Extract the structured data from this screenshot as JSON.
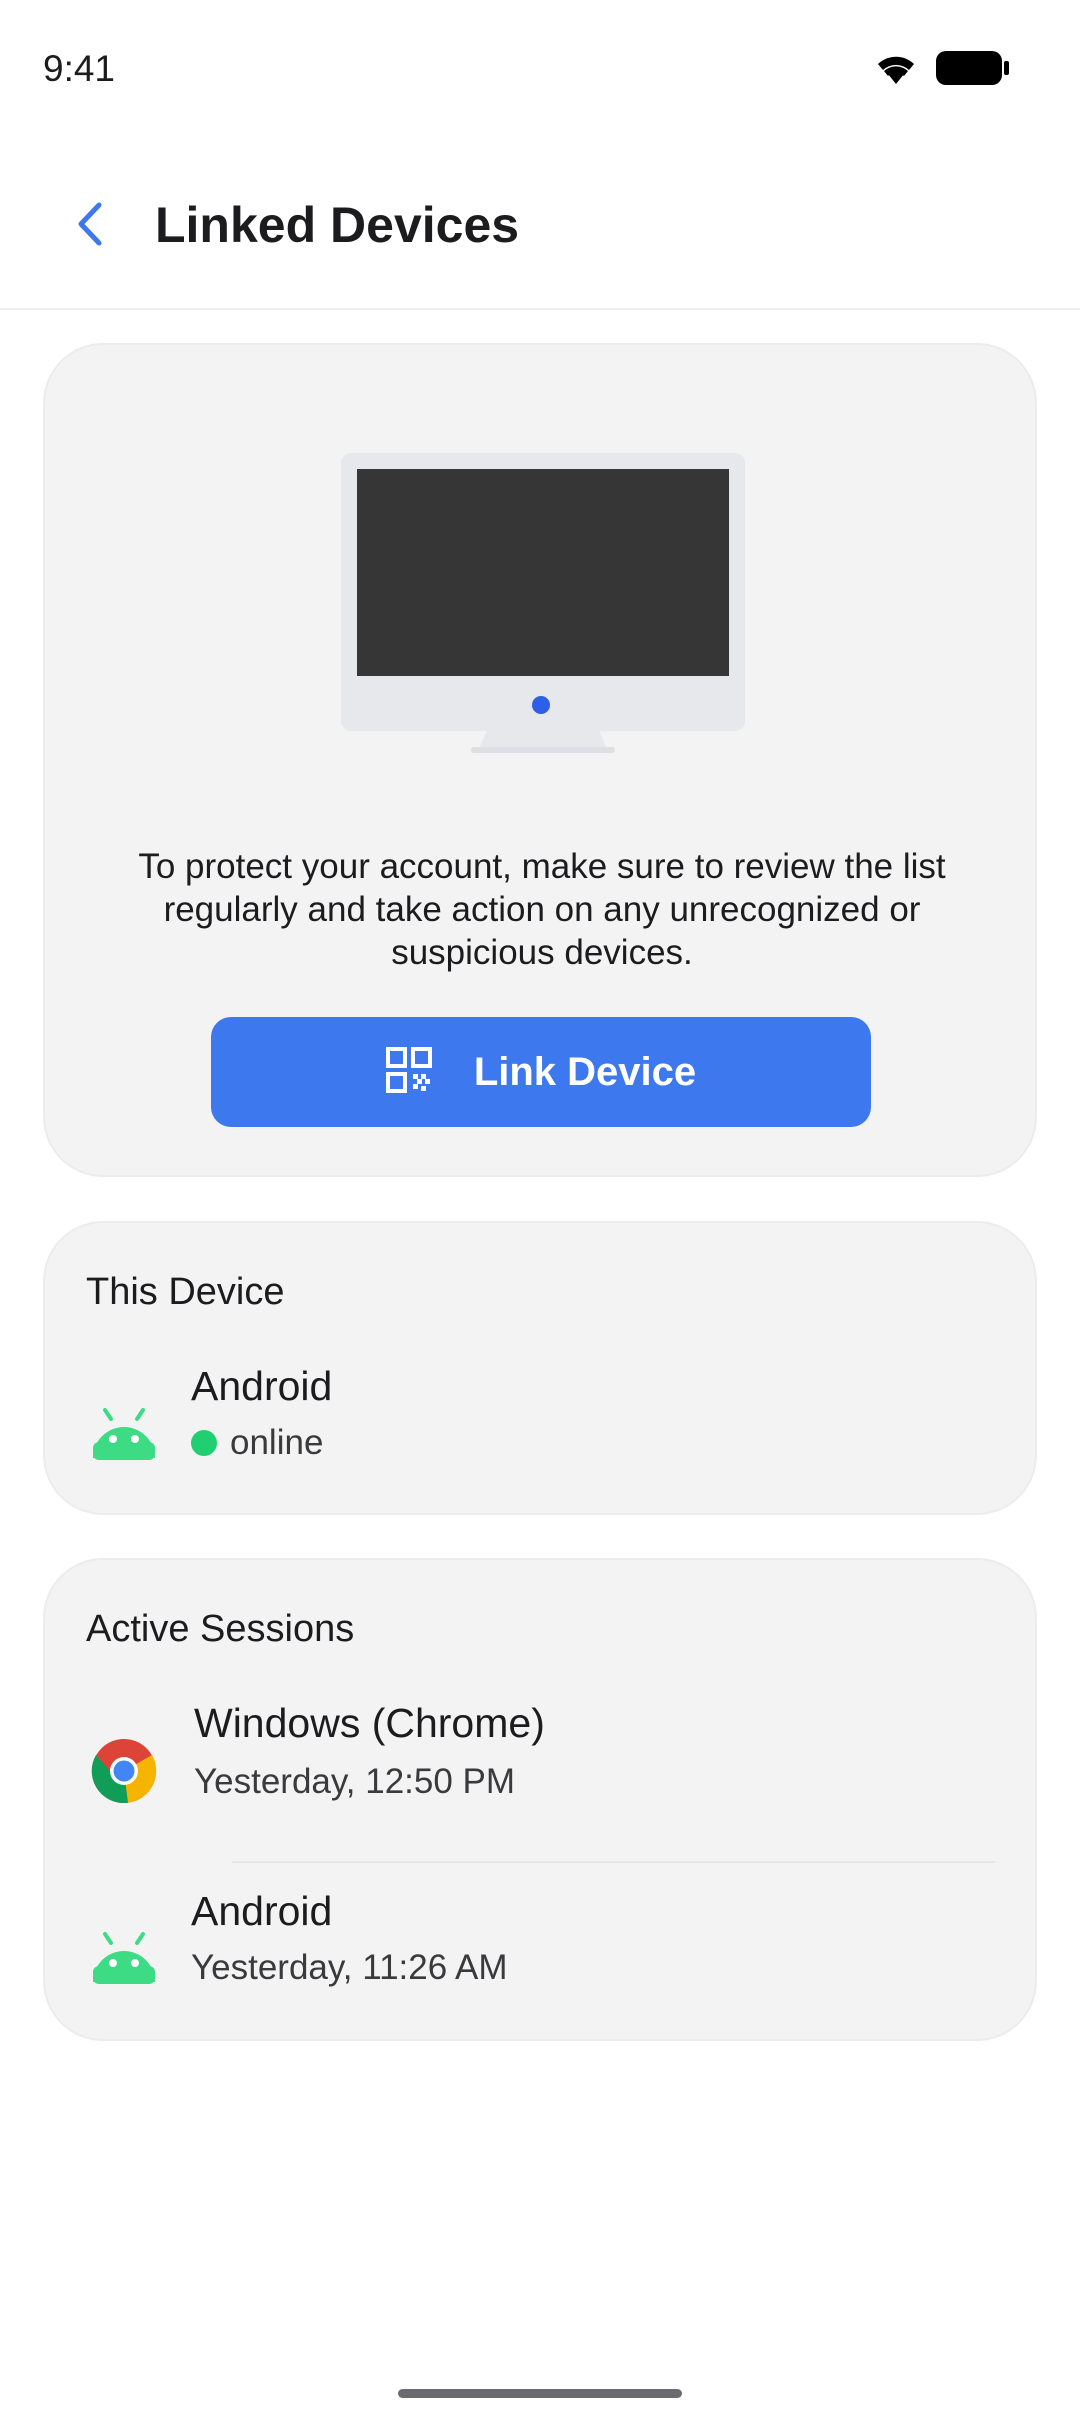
{
  "status_bar": {
    "time": "9:41",
    "icons": [
      "wifi-icon",
      "battery-icon"
    ]
  },
  "header": {
    "title": "Linked Devices",
    "back_icon": "chevron-left-icon"
  },
  "hero": {
    "illustration": "monitor-icon",
    "description": "To protect your account, make sure to review the list regularly and take action on any unrecognized or suspicious devices.",
    "button_label": "Link Device",
    "button_icon": "qr-code-icon"
  },
  "this_device": {
    "title": "This Device",
    "device": {
      "name": "Android",
      "status": "online",
      "icon": "android-icon"
    }
  },
  "active_sessions": {
    "title": "Active Sessions",
    "items": [
      {
        "name": "Windows (Chrome)",
        "time": "Yesterday, 12:50 PM",
        "icon": "chrome-icon"
      },
      {
        "name": "Android",
        "time": "Yesterday, 11:26 AM",
        "icon": "android-icon"
      }
    ]
  },
  "colors": {
    "accent": "#3d78ee",
    "card_bg": "#f3f3f4",
    "online": "#1fcf72",
    "android": "#3ddc84"
  }
}
